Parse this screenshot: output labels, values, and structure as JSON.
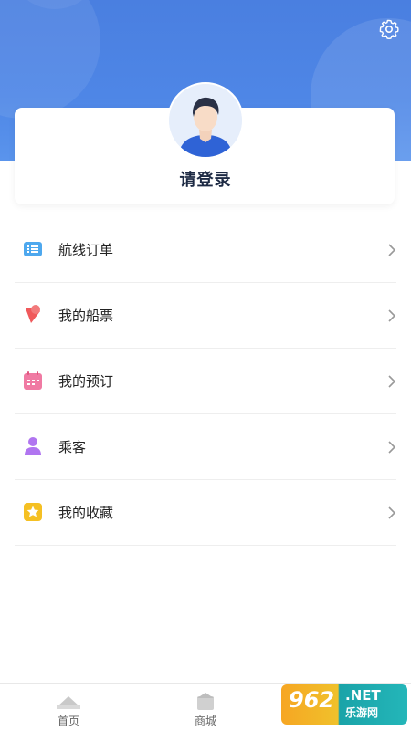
{
  "profile": {
    "login_text": "请登录"
  },
  "menu": {
    "items": [
      {
        "label": "航线订单",
        "icon": "list-icon",
        "color": "#4ea8ee"
      },
      {
        "label": "我的船票",
        "icon": "ticket-icon",
        "color": "#f0595b"
      },
      {
        "label": "我的预订",
        "icon": "calendar-icon",
        "color": "#f07aa3"
      },
      {
        "label": "乘客",
        "icon": "person-icon",
        "color": "#b075f0"
      },
      {
        "label": "我的收藏",
        "icon": "star-icon",
        "color": "#f5c023"
      }
    ]
  },
  "tabbar": {
    "items": [
      {
        "label": "首页",
        "icon": "home-icon"
      },
      {
        "label": "商城",
        "icon": "shop-icon"
      }
    ]
  },
  "watermark": {
    "num": "962",
    "net": ".NET",
    "sub": "乐游网"
  },
  "colors": {
    "header": "#4e86e6",
    "text": "#222222"
  }
}
